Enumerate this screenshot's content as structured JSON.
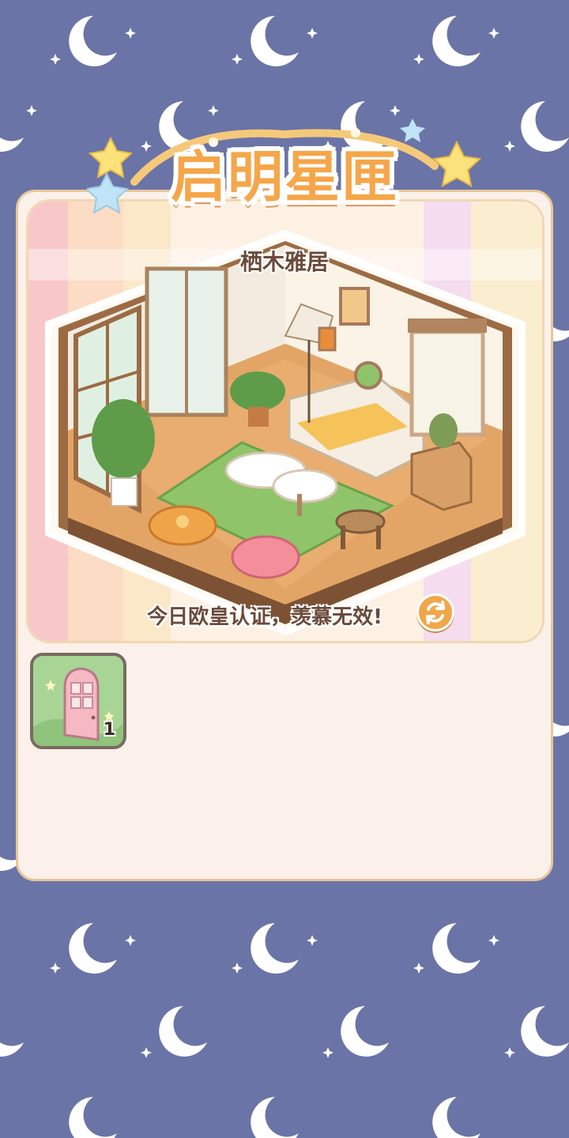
{
  "title": "启明星匣",
  "room": {
    "name": "栖木雅居",
    "caption": "今日欧皇认证，羡慕无效!"
  },
  "refresh_icon": "refresh-icon",
  "items": [
    {
      "icon": "pink-door-icon",
      "count": "1"
    }
  ],
  "colors": {
    "background": "#6b74a6",
    "panel": "#fbf1ea",
    "title": "#f6a64a",
    "accent": "#f2a64a"
  }
}
